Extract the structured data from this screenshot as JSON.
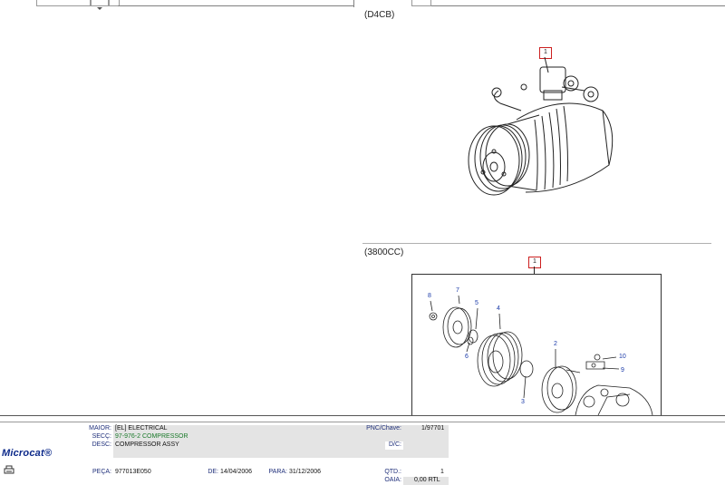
{
  "top_panel": {
    "header": "(D4CB)",
    "callout": "1"
  },
  "bottom_panel": {
    "header": "(3800CC)",
    "callout_box": "1",
    "callouts": [
      "8",
      "7",
      "5",
      "6",
      "4",
      "3",
      "2",
      "10",
      "9"
    ]
  },
  "info": {
    "logo": "Microcat®",
    "maior_label": "MAIOR:",
    "maior_value": "[EL]  ELECTRICAL",
    "secc_label": "SECÇ:",
    "secc_value": "97-976-2  COMPRESSOR",
    "desc_label": "DESC:",
    "desc_value": "COMPRESSOR ASSY",
    "pnc_label": "PNC/Chave:",
    "pnc_value": "1/97701",
    "dc_label": "D/C:",
    "dc_value": "",
    "peca_label": "PEÇA:",
    "peca_value": "977013E050",
    "de_label": "DE:",
    "de_value": "14/04/2006",
    "para_label": "PARA:",
    "para_value": "31/12/2006",
    "qtd_label": "QTD.:",
    "qtd_value": "1",
    "oaia_label": "OAIA:",
    "oaia_value": "0,00 RTL"
  },
  "icons": [
    "dropdown-arrow-icon",
    "compressor-illustration",
    "exploded-compressor-illustration",
    "printer-icon"
  ]
}
